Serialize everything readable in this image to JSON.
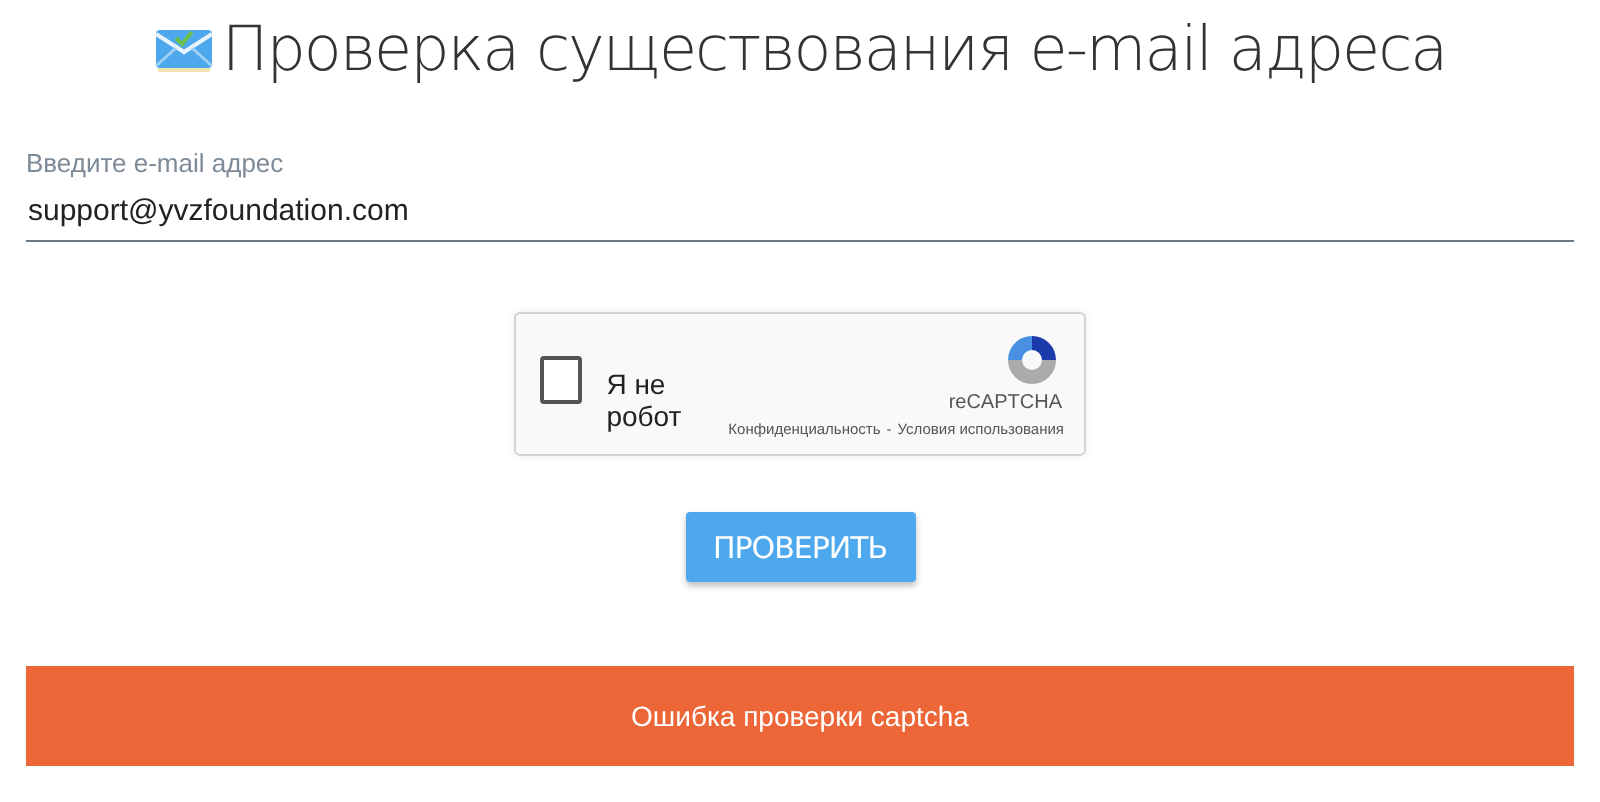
{
  "title": "Проверка существования e-mail адреса",
  "email_field": {
    "label": "Введите e-mail адрес",
    "value": "support@yvzfoundation.com"
  },
  "captcha": {
    "checked": false,
    "label": "Я не робот",
    "brand": "reCAPTCHA",
    "links": [
      "Конфиденциальность",
      "Условия использования"
    ],
    "separator": "-"
  },
  "submit_button": "ПРОВЕРИТЬ",
  "error_message": "Ошибка проверки captcha"
}
